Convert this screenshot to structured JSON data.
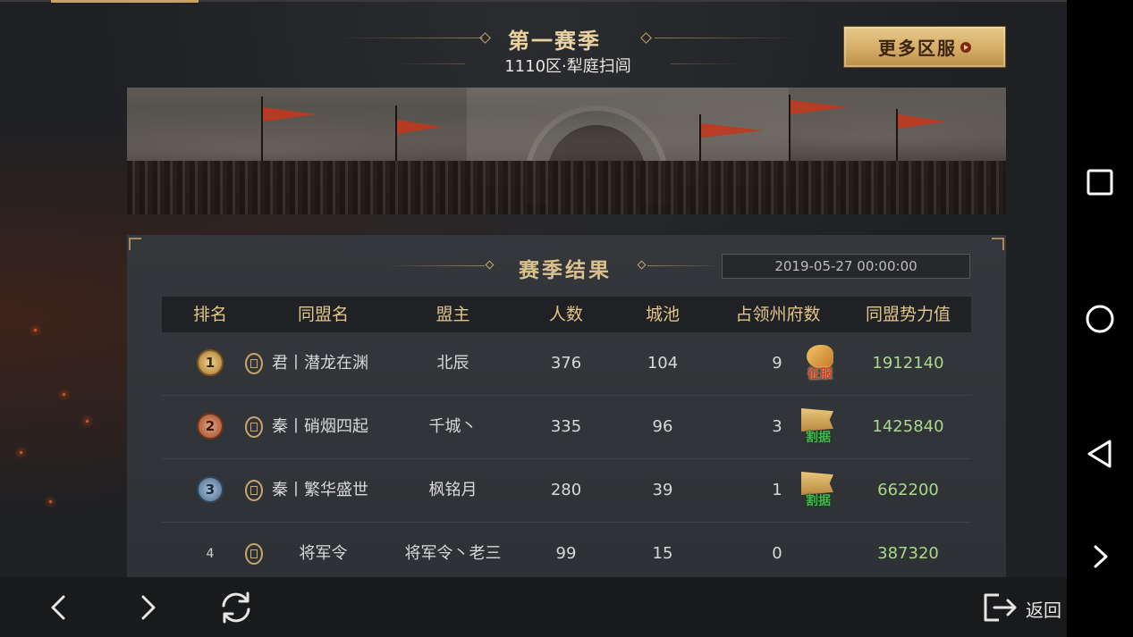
{
  "header": {
    "season_title": "第一赛季",
    "server_name": "1110区·犁庭扫闾",
    "more_servers_label": "更多区服"
  },
  "results": {
    "title": "赛季结果",
    "date": "2019-05-27 00:00:00",
    "columns": [
      "排名",
      "同盟名",
      "盟主",
      "人数",
      "城池",
      "占领州府数",
      "同盟势力值"
    ],
    "rows": [
      {
        "rank": "1",
        "alliance": "君丨潜龙在渊",
        "leader": "北辰",
        "members": "376",
        "cities": "104",
        "prefectures": "9",
        "status": "征服",
        "status_type": "conquer",
        "power": "1912140"
      },
      {
        "rank": "2",
        "alliance": "秦丨硝烟四起",
        "leader": "千城丶",
        "members": "335",
        "cities": "96",
        "prefectures": "3",
        "status": "割据",
        "status_type": "separatist",
        "power": "1425840"
      },
      {
        "rank": "3",
        "alliance": "秦丨繁华盛世",
        "leader": "枫铭月",
        "members": "280",
        "cities": "39",
        "prefectures": "1",
        "status": "割据",
        "status_type": "separatist",
        "power": "662200"
      },
      {
        "rank": "4",
        "alliance": "将军令",
        "leader": "将军令丶老三",
        "members": "99",
        "cities": "15",
        "prefectures": "0",
        "status": "",
        "status_type": "none",
        "power": "387320"
      }
    ]
  },
  "toolbar": {
    "back_icon": "chevron-left-icon",
    "forward_icon": "chevron-right-icon",
    "refresh_icon": "refresh-icon",
    "return_icon": "exit-icon",
    "return_label": "返回"
  },
  "nav": {
    "icons": [
      "recents-square-icon",
      "home-circle-icon",
      "back-triangle-icon",
      "chevron-right-icon"
    ]
  },
  "colors": {
    "accent_gold": "#d9c08d",
    "power_green": "#a9d98a",
    "button_gold": "#d4ad66"
  }
}
